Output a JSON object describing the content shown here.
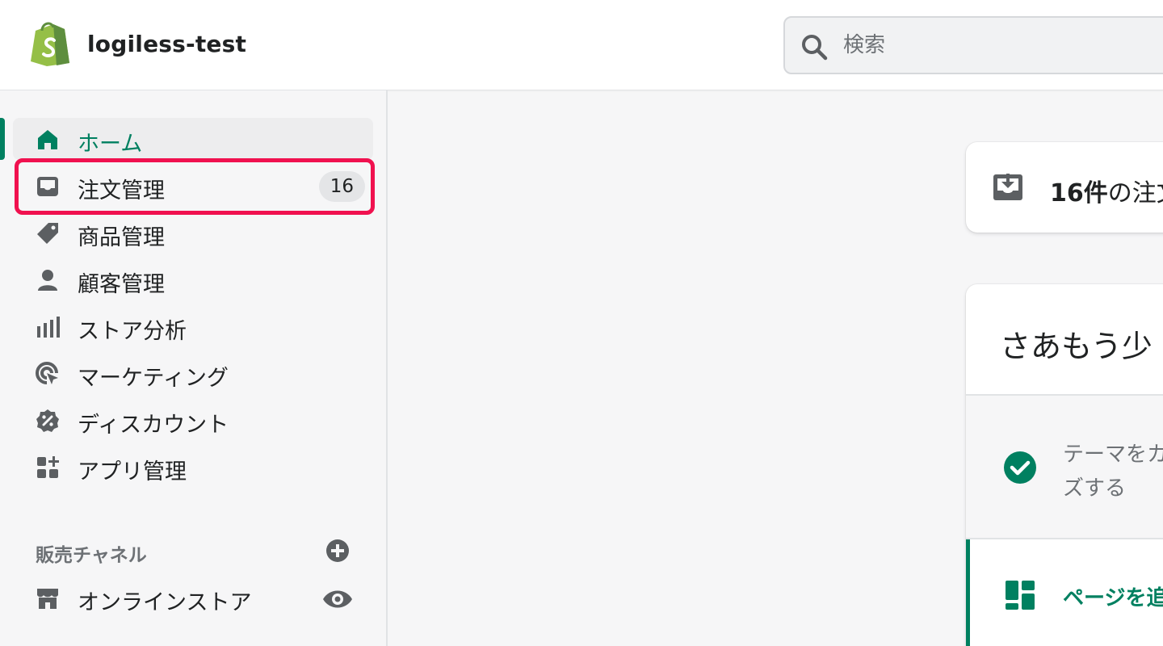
{
  "header": {
    "store_name": "logiless-test",
    "search_placeholder": "検索"
  },
  "sidebar": {
    "items": [
      {
        "label": "ホーム",
        "icon": "home-icon",
        "active": true
      },
      {
        "label": "注文管理",
        "icon": "inbox-icon",
        "badge": "16"
      },
      {
        "label": "商品管理",
        "icon": "tag-icon"
      },
      {
        "label": "顧客管理",
        "icon": "person-icon"
      },
      {
        "label": "ストア分析",
        "icon": "bar-chart-icon"
      },
      {
        "label": "マーケティング",
        "icon": "target-icon"
      },
      {
        "label": "ディスカウント",
        "icon": "discount-icon"
      },
      {
        "label": "アプリ管理",
        "icon": "apps-icon"
      }
    ],
    "sales_channels": {
      "title": "販売チャネル",
      "items": [
        {
          "label": "オンラインストア",
          "icon": "store-icon"
        }
      ]
    }
  },
  "main": {
    "orders_card": {
      "count": "16件",
      "text": "の注文"
    },
    "setup_card": {
      "title": "さあもう少",
      "task1_line1": "テーマをカ",
      "task1_line2": "ズする",
      "task2_label": "ページを追"
    }
  },
  "colors": {
    "accent": "#008060",
    "highlight": "#f0114f",
    "icon": "#5c5f62"
  }
}
